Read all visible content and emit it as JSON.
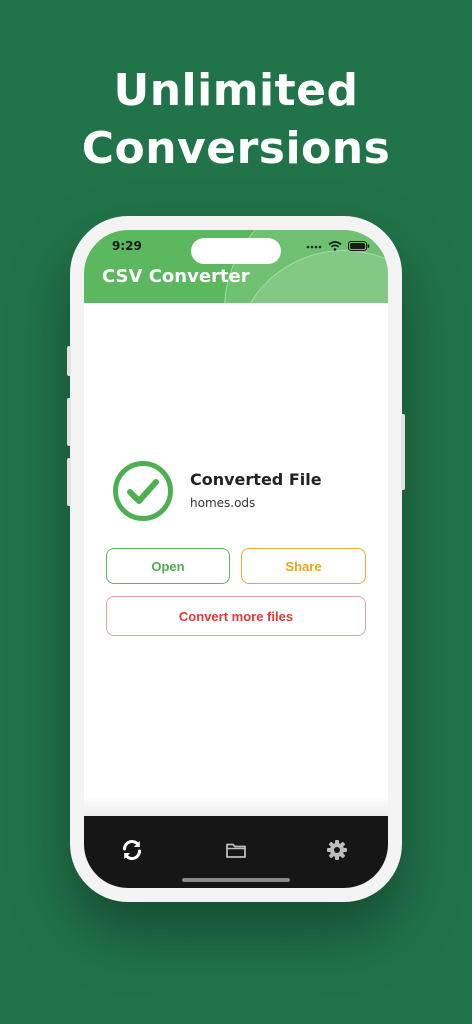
{
  "promo": {
    "headline_line1": "Unlimited",
    "headline_line2": "Conversions"
  },
  "status_bar": {
    "time": "9:29",
    "icons": [
      "signal-dots-icon",
      "wifi-icon",
      "battery-icon"
    ]
  },
  "app": {
    "title": "CSV Converter"
  },
  "result": {
    "status_icon": "check-circle-icon",
    "title": "Converted File",
    "filename": "homes.ods"
  },
  "actions": {
    "open_label": "Open",
    "share_label": "Share",
    "convert_more_label": "Convert more files"
  },
  "tabbar": {
    "items": [
      {
        "icon": "sync-icon",
        "active": true
      },
      {
        "icon": "folder-icon",
        "active": false
      },
      {
        "icon": "gear-icon",
        "active": false
      }
    ]
  },
  "colors": {
    "background": "#21744a",
    "app_bar": "#5cb85e",
    "open": "#4caf50",
    "share": "#f0a020",
    "convert_more": "#e53935",
    "tab_bar": "#161616"
  }
}
